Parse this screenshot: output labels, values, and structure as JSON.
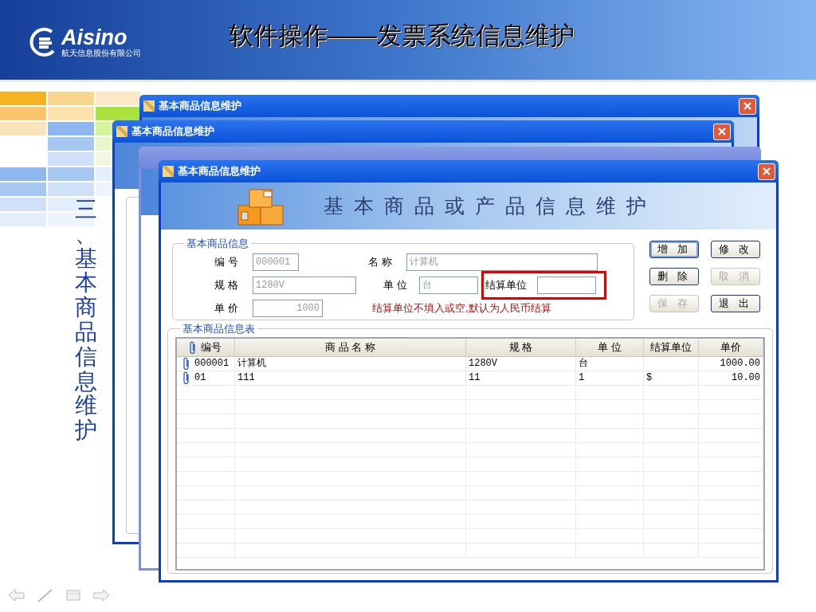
{
  "header": {
    "logo_name": "Aisino",
    "logo_subtitle": "航天信息股份有限公司",
    "title": "软件操作——发票系统信息维护"
  },
  "side_heading": "三、基本商品信息维护",
  "background_windows": [
    {
      "title": "基本商品信息维护"
    },
    {
      "title": "基本商品信息维护"
    }
  ],
  "window": {
    "title": "基本商品信息维护",
    "banner": "基本商品或产品信息维护",
    "info_group": {
      "label": "基本商品信息",
      "rows": [
        [
          {
            "kind": "text",
            "label": "编 号",
            "value": "000001",
            "disabled": true,
            "highlighted": false
          },
          {
            "kind": "text",
            "label": "名 称",
            "value": "计算机",
            "disabled": true,
            "highlighted": false
          }
        ],
        [
          {
            "kind": "text",
            "label": "规 格",
            "value": "1280V",
            "disabled": true,
            "highlighted": false
          },
          {
            "kind": "text",
            "label": "单 位",
            "value": "台",
            "disabled": true,
            "highlighted": false
          },
          {
            "kind": "text",
            "label": "结算单位",
            "disabled": false,
            "highlighted": true
          }
        ],
        [
          {
            "kind": "number",
            "label": "单 价",
            "value": "1000",
            "disabled": true,
            "highlighted": false
          }
        ]
      ],
      "note": "结算单位不填入或空,默认为人民币结算"
    },
    "buttons": [
      {
        "label": "增 加",
        "disabled": false,
        "focused": true
      },
      {
        "label": "修 改",
        "disabled": false,
        "focused": false
      },
      {
        "label": "删 除",
        "disabled": false,
        "focused": false
      },
      {
        "label": "取 消",
        "disabled": true,
        "focused": false
      },
      {
        "label": "保 存",
        "disabled": true,
        "focused": false
      },
      {
        "label": "退 出",
        "disabled": false,
        "focused": false
      }
    ],
    "table": {
      "label": "基本商品信息表",
      "columns": [
        "编号",
        "商 品 名 称",
        "规 格",
        "单 位",
        "结算单位",
        "单价"
      ],
      "rows": [
        [
          "000001",
          "计算机",
          "1280V",
          "台",
          "",
          "1000.00"
        ],
        [
          "01",
          "111",
          "11",
          "1",
          "$",
          "10.00"
        ]
      ]
    }
  }
}
